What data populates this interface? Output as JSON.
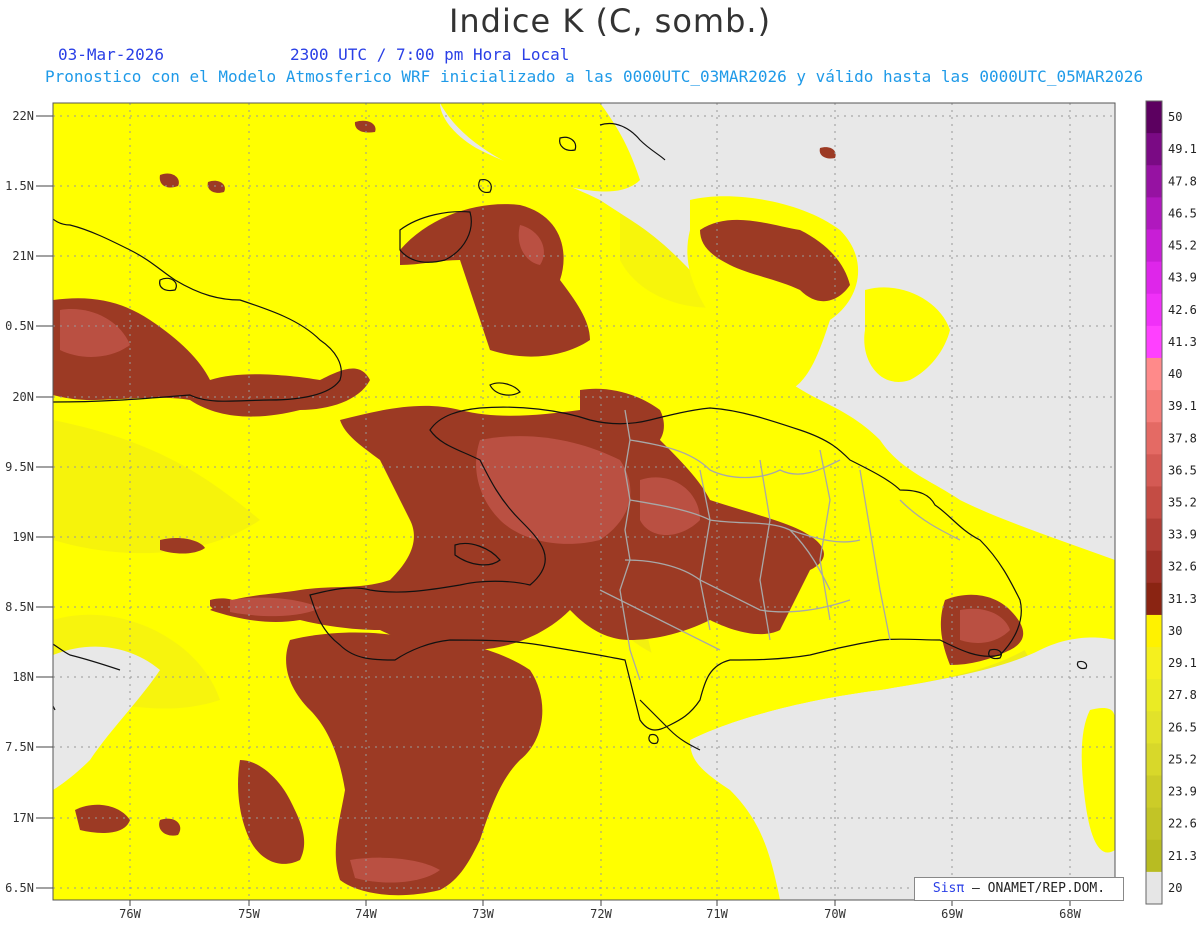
{
  "header": {
    "title": "Indice K (C, somb.)",
    "date": "03-Mar-2026",
    "time": "2300 UTC / 7:00 pm Hora Local",
    "description": "Pronostico con el Modelo Atmosferico WRF inicializado a las 0000UTC_03MAR2026 y válido hasta las  0000UTC_05MAR2026"
  },
  "map": {
    "lat_labels": [
      "22N",
      "1.5N",
      "21N",
      "0.5N",
      "20N",
      "9.5N",
      "19N",
      "8.5N",
      "18N",
      "7.5N",
      "17N",
      "6.5N"
    ],
    "lon_labels": [
      "76W",
      "75W",
      "74W",
      "73W",
      "72W",
      "71W",
      "70W",
      "69W",
      "68W"
    ]
  },
  "colorbar": {
    "labels": [
      "50",
      "49.1",
      "47.8",
      "46.5",
      "45.2",
      "43.9",
      "42.6",
      "41.3",
      "40",
      "39.1",
      "37.8",
      "36.5",
      "35.2",
      "33.9",
      "32.6",
      "31.3",
      "30",
      "29.1",
      "27.8",
      "26.5",
      "25.2",
      "23.9",
      "22.6",
      "21.3",
      "20"
    ],
    "colors": [
      "#5c0060",
      "#7a0a84",
      "#9612a2",
      "#b018be",
      "#c81ed6",
      "#de26ea",
      "#f030f8",
      "#ff40ff",
      "#ff8a8a",
      "#f47c78",
      "#e46a64",
      "#d45a54",
      "#c44c44",
      "#b03e36",
      "#9e3026",
      "#8a2412",
      "#fff200",
      "#f5f01e",
      "#eaeb24",
      "#e2e22a",
      "#d8d82a",
      "#cccc28",
      "#c2c426",
      "#b8bc22"
    ]
  },
  "credit": {
    "sis": "Sisπ",
    "org": " – ONAMET/REP.DOM."
  }
}
